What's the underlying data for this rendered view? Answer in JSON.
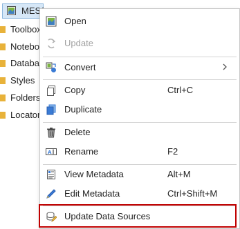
{
  "tree": {
    "selected_label": "MES/",
    "items": [
      "Toolbox",
      "Notebo",
      "Databas",
      "Styles",
      "Folders",
      "Locators"
    ]
  },
  "menu": {
    "items": [
      {
        "label": "Open",
        "shortcut": "",
        "icon": "map-open-icon",
        "enabled": true
      },
      {
        "label": "Update",
        "shortcut": "",
        "icon": "update-icon",
        "enabled": false
      },
      {
        "label": "Convert",
        "shortcut": "",
        "icon": "convert-icon",
        "enabled": true,
        "submenu": true
      },
      {
        "label": "Copy",
        "shortcut": "Ctrl+C",
        "icon": "copy-icon",
        "enabled": true
      },
      {
        "label": "Duplicate",
        "shortcut": "",
        "icon": "duplicate-icon",
        "enabled": true
      },
      {
        "label": "Delete",
        "shortcut": "",
        "icon": "trash-icon",
        "enabled": true
      },
      {
        "label": "Rename",
        "shortcut": "F2",
        "icon": "rename-icon",
        "enabled": true
      },
      {
        "label": "View Metadata",
        "shortcut": "Alt+M",
        "icon": "view-metadata-icon",
        "enabled": true
      },
      {
        "label": "Edit Metadata",
        "shortcut": "Ctrl+Shift+M",
        "icon": "edit-metadata-icon",
        "enabled": true
      },
      {
        "label": "Update Data Sources",
        "shortcut": "",
        "icon": "update-data-sources-icon",
        "enabled": true,
        "highlighted": true
      }
    ]
  },
  "colors": {
    "highlight_border": "#c00000",
    "selection_bg": "#d6e7f7",
    "folder_yellow": "#e8b23a",
    "icon_blue": "#3a7bd5"
  }
}
